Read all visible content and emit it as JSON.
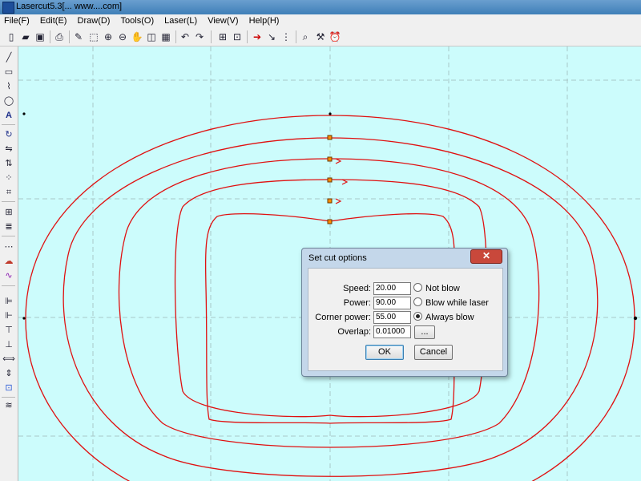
{
  "window": {
    "title": "Lasercut5.3[... www....com]"
  },
  "menu": [
    "File(F)",
    "Edit(E)",
    "Draw(D)",
    "Tools(O)",
    "Laser(L)",
    "View(V)",
    "Help(H)"
  ],
  "toolbar_icons": [
    "new-file-icon",
    "open-folder-icon",
    "save-icon",
    "print-icon",
    "pen-icon",
    "select-icon",
    "zoom-in-icon",
    "zoom-out-icon",
    "pan-hand-icon",
    "zoom-fit-icon",
    "zoom-page-icon",
    "undo-icon",
    "redo-icon",
    "group-icon",
    "ungroup-icon",
    "start-point-icon",
    "direction-icon",
    "array-icon",
    "preview-icon",
    "laser-output-icon",
    "alarm-clock-icon"
  ],
  "left_tools": [
    "line-tool-icon",
    "rectangle-tool-icon",
    "polyline-tool-icon",
    "ellipse-tool-icon",
    "text-tool-icon",
    "rotate-icon",
    "mirror-horizontal-icon",
    "mirror-vertical-icon",
    "node-edit-icon",
    "crop-icon",
    "grid-array-icon",
    "hatch-fill-icon",
    "dotted-hatch-icon",
    "offset-icon",
    "smooth-curve-icon",
    "align-left-icon",
    "align-right-icon",
    "align-top-icon",
    "align-bottom-icon",
    "distribute-h-icon",
    "distribute-v-icon",
    "center-icon",
    "layers-icon"
  ],
  "dialog": {
    "title": "Set cut options",
    "close": "✕",
    "speed_label": "Speed:",
    "speed_value": "20.00",
    "power_label": "Power:",
    "power_value": "90.00",
    "corner_power_label": "Corner power:",
    "corner_power_value": "55.00",
    "overlap_label": "Overlap:",
    "overlap_value": "0.01000",
    "browse_label": "...",
    "radio_not_blow": "Not blow",
    "radio_blow_while_laser": "Blow while laser",
    "radio_always_blow": "Always blow",
    "selected_option": "Always blow",
    "ok_label": "OK",
    "cancel_label": "Cancel"
  },
  "colors": {
    "canvas": "#ccfcfc",
    "cut_line": "#e01010",
    "node": "#ff8c00"
  }
}
